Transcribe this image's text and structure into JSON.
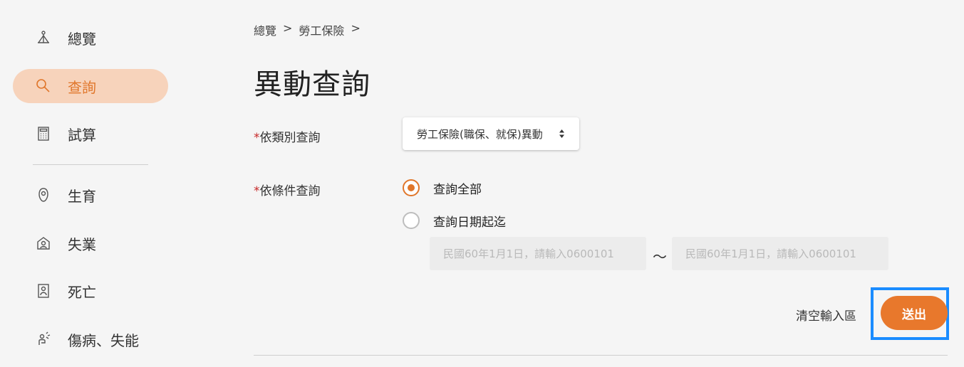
{
  "sidebar": {
    "items": [
      {
        "label": "總覽",
        "icon": "overview-icon"
      },
      {
        "label": "查詢",
        "icon": "search-icon",
        "active": true
      },
      {
        "label": "試算",
        "icon": "calculator-icon"
      },
      {
        "label": "生育",
        "icon": "birth-icon"
      },
      {
        "label": "失業",
        "icon": "unemployment-icon"
      },
      {
        "label": "死亡",
        "icon": "death-icon"
      },
      {
        "label": "傷病、失能",
        "icon": "injury-icon"
      }
    ]
  },
  "breadcrumb": {
    "items": [
      "總覽",
      "勞工保險"
    ],
    "separator": ">"
  },
  "page": {
    "title": "異動查詢"
  },
  "form": {
    "category": {
      "required_mark": "*",
      "label": "依類別查詢",
      "selected": "勞工保險(職保、就保)異動"
    },
    "condition": {
      "required_mark": "*",
      "label": "依條件查詢",
      "options": [
        {
          "label": "查詢全部",
          "checked": true
        },
        {
          "label": "查詢日期起迄",
          "checked": false
        }
      ],
      "date_from_placeholder": "民國60年1月1日，請輸入0600101",
      "date_to_placeholder": "民國60年1月1日，請輸入0600101",
      "range_separator": "～"
    },
    "clear_label": "清空輸入區",
    "submit_label": "送出"
  },
  "colors": {
    "accent": "#e8782c",
    "active_nav_bg": "#f7d3bb",
    "required": "#c62828",
    "highlight_frame": "#1a8cff"
  }
}
